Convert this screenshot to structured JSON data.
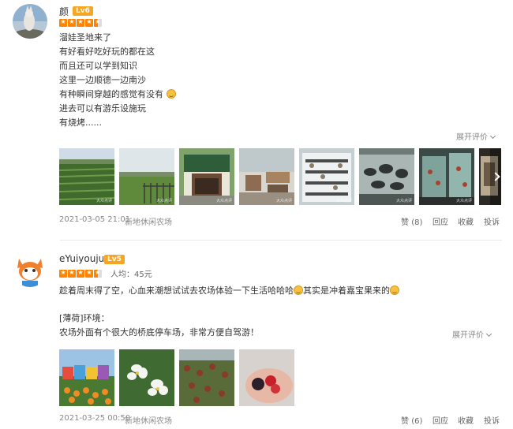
{
  "reviews": [
    {
      "username": "颜",
      "level": "Lv6",
      "rating": 4.5,
      "lines": [
        "溜娃圣地来了",
        "有好看好吃好玩的都在这",
        "而且还可以学到知识",
        "这里一边顺德一边南沙",
        "有种瞬间穿越的感觉有没有",
        "进去可以有游乐设施玩",
        "有烧烤......"
      ],
      "expand_label": "展开评价",
      "date": "2021-03-05 21:01",
      "shop": "新地休闲农场",
      "like_label": "赞",
      "like_count": "(8)",
      "reply_label": "回应",
      "fav_label": "收藏",
      "report_label": "投诉"
    },
    {
      "username": "eYuiyoujun",
      "level": "Lv5",
      "rating": 4.5,
      "price_label": "人均：",
      "price_value": "45元",
      "line1a": "趁着周末得了空，心血来潮想试试去农场体验一下生活哈哈哈",
      "line1b": "其实是冲着嘉宝果来的",
      "line2": "[薄荷]环境：",
      "line3": "农场外面有个很大的桥底停车场，非常方便自驾游！",
      "expand_label": "展开评价",
      "date": "2021-03-25 00:50",
      "shop": "新地休闲农场",
      "like_label": "赞",
      "like_count": "(6)",
      "reply_label": "回应",
      "fav_label": "收藏",
      "report_label": "投诉"
    }
  ],
  "colors": {
    "star": "#ff8400",
    "level_badge": "#f5a623",
    "meta_text": "#888888"
  }
}
